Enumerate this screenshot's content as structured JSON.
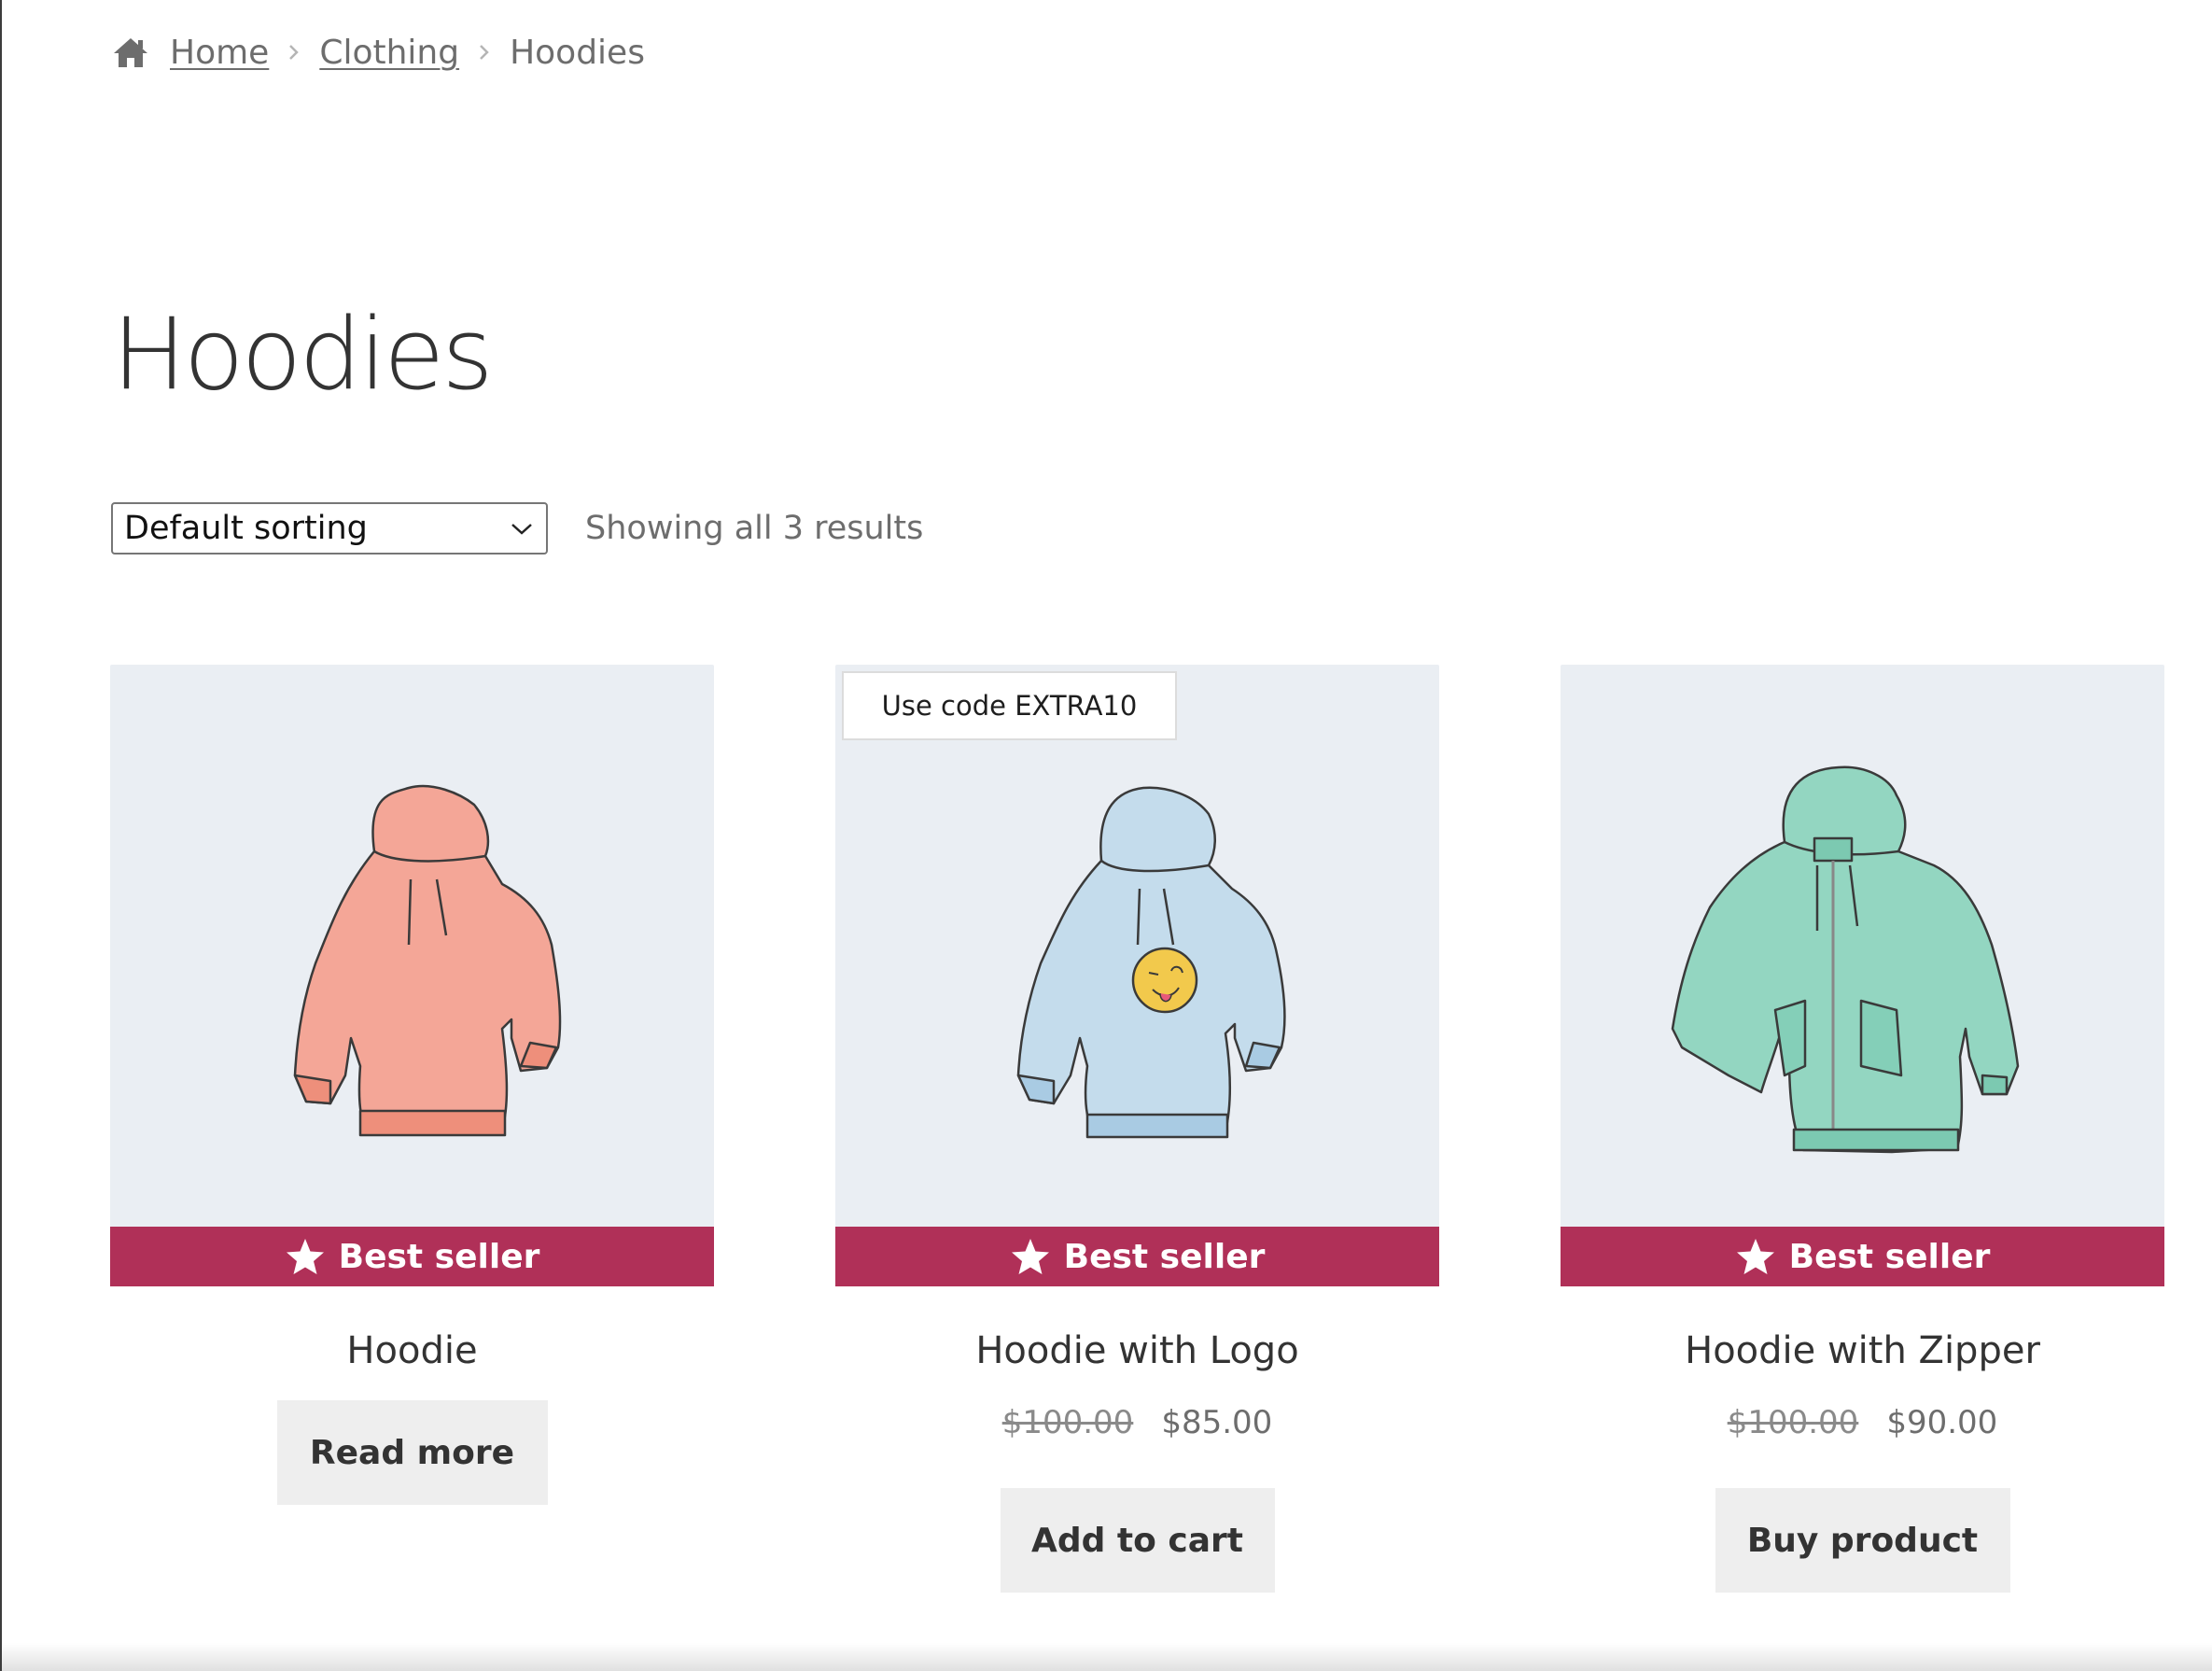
{
  "breadcrumb": {
    "home_label": "Home",
    "clothing_label": "Clothing",
    "current_label": "Hoodies"
  },
  "page_title": "Hoodies",
  "sorting": {
    "selected": "Default sorting"
  },
  "result_count": "Showing all 3 results",
  "colors": {
    "badge": "#b03058",
    "image_bg": "#eaeef3",
    "button_bg": "#eeeeee"
  },
  "products": [
    {
      "name": "Hoodie",
      "badge": "Best seller",
      "button": "Read more",
      "color": "#f4a697"
    },
    {
      "name": "Hoodie with Logo",
      "badge": "Best seller",
      "coupon": "Use code EXTRA10",
      "old_price": "$100.00",
      "price": "$85.00",
      "button": "Add to cart",
      "color": "#c4dcec"
    },
    {
      "name": "Hoodie with Zipper",
      "badge": "Best seller",
      "old_price": "$100.00",
      "price": "$90.00",
      "button": "Buy product",
      "color": "#93d6c1"
    }
  ]
}
